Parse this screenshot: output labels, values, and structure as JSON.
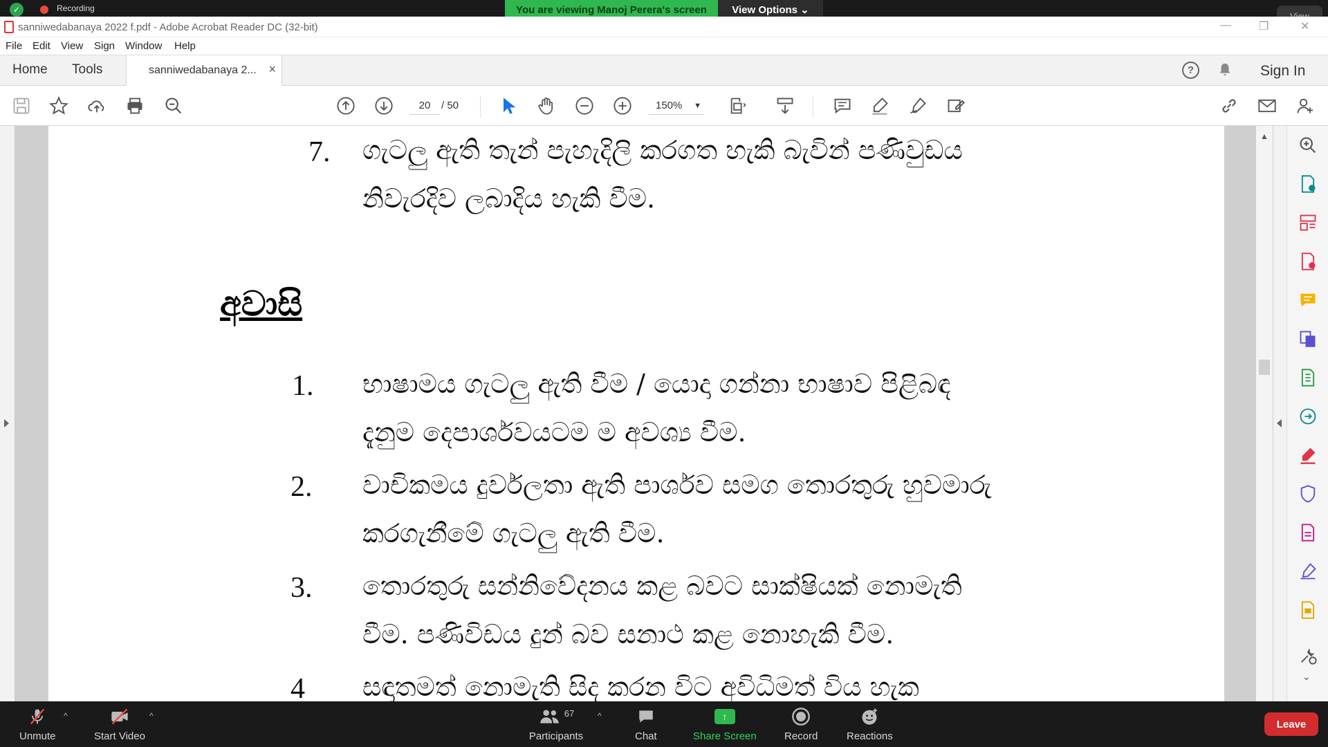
{
  "zoom": {
    "recording_label": "Recording",
    "viewing_banner": "You are viewing Manoj Perera's screen",
    "view_options": "View Options ⌄",
    "view_button": "View",
    "bottom": {
      "unmute": "Unmute",
      "start_video": "Start Video",
      "participants": "Participants",
      "participants_count": "67",
      "chat": "Chat",
      "share_screen": "Share Screen",
      "record": "Record",
      "reactions": "Reactions",
      "leave": "Leave"
    }
  },
  "window": {
    "title": "sanniwedabanaya 2022  f.pdf - Adobe Acrobat Reader DC (32-bit)"
  },
  "menu": [
    "File",
    "Edit",
    "View",
    "Sign",
    "Window",
    "Help"
  ],
  "tabs": {
    "home": "Home",
    "tools": "Tools",
    "document": "sanniwedabanaya 2...",
    "close": "×",
    "sign_in": "Sign In",
    "help": "?"
  },
  "toolbar": {
    "page_current": "20",
    "page_total": "/  50",
    "zoom": "150%"
  },
  "document": {
    "item7_num": "7.",
    "item7_line1": "ගැටලු ඇති තැන් පැහැදිලි කරගත හැකි බැවින් පණිවුඩය",
    "item7_line2": "නිවැරදිව ලබාදිය හැකි වීම.",
    "heading": "අවාසි",
    "item1_num": "1.",
    "item1_line1": "භාෂාමය ගැටලු ඇති වීම / යොදා ගන්නා භාෂාව පිළිබඳ",
    "item1_line2": "දැනුම දෙපාර්ශවයටම ම අවශ්‍ය වීම.",
    "item2_num": "2.",
    "item2_line1": "වාචිකමය දුර්වලතා ඇති පාර්ශව සමග තොරතුරු හුවමාරු",
    "item2_line2": "කරගැනීමේ ගැටලු ඇති වීම.",
    "item3_num": "3.",
    "item3_line1": "තොරතුරු සන්නිවේදනය කළ බවට සාක්ෂියක් නොමැති",
    "item3_line2": "වීම. පණිවිඩය දුන් බව සනාථ කළ නොහැකි වීම.",
    "item4_num": "4",
    "item4_line1": "සඳාතමත් නොමැති සිද කරන විට අවිධිමත් විය හැක"
  }
}
